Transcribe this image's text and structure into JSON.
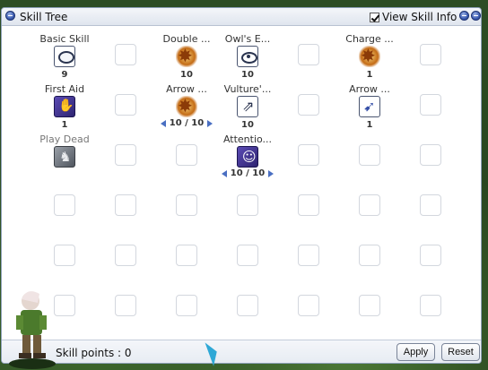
{
  "window": {
    "title": "Skill Tree",
    "view_skill_info_label": "View Skill Info",
    "view_skill_info_checked": true
  },
  "skills": [
    {
      "name": "Basic Skill",
      "level": "9",
      "icon": "bubble-icon",
      "adjustable": false,
      "col": 0,
      "row": 0
    },
    {
      "name": "Double ...",
      "level": "10",
      "icon": "burst-icon",
      "adjustable": false,
      "col": 2,
      "row": 0
    },
    {
      "name": "Owl's E...",
      "level": "10",
      "icon": "eye-icon",
      "adjustable": false,
      "col": 3,
      "row": 0
    },
    {
      "name": "Charge ...",
      "level": "1",
      "icon": "burst-icon",
      "adjustable": false,
      "col": 5,
      "row": 0
    },
    {
      "name": "First Aid",
      "level": "1",
      "icon": "hand-icon",
      "adjustable": false,
      "col": 0,
      "row": 1
    },
    {
      "name": "Arrow ...",
      "level": "10 / 10",
      "icon": "burst-icon",
      "adjustable": true,
      "col": 2,
      "row": 1
    },
    {
      "name": "Vulture'...",
      "level": "10",
      "icon": "hawk-icon",
      "adjustable": false,
      "col": 3,
      "row": 1
    },
    {
      "name": "Arrow ...",
      "level": "1",
      "icon": "arrow-icon",
      "adjustable": false,
      "col": 5,
      "row": 1
    },
    {
      "name": "Play Dead",
      "level": "",
      "icon": "play-dead-icon",
      "adjustable": false,
      "col": 0,
      "row": 2,
      "disabled": true
    },
    {
      "name": "Attentio...",
      "level": "10 / 10",
      "icon": "attention-icon",
      "adjustable": true,
      "col": 3,
      "row": 2
    }
  ],
  "footer": {
    "skill_points_label": "Skill points : 0",
    "apply_label": "Apply",
    "reset_label": "Reset"
  }
}
